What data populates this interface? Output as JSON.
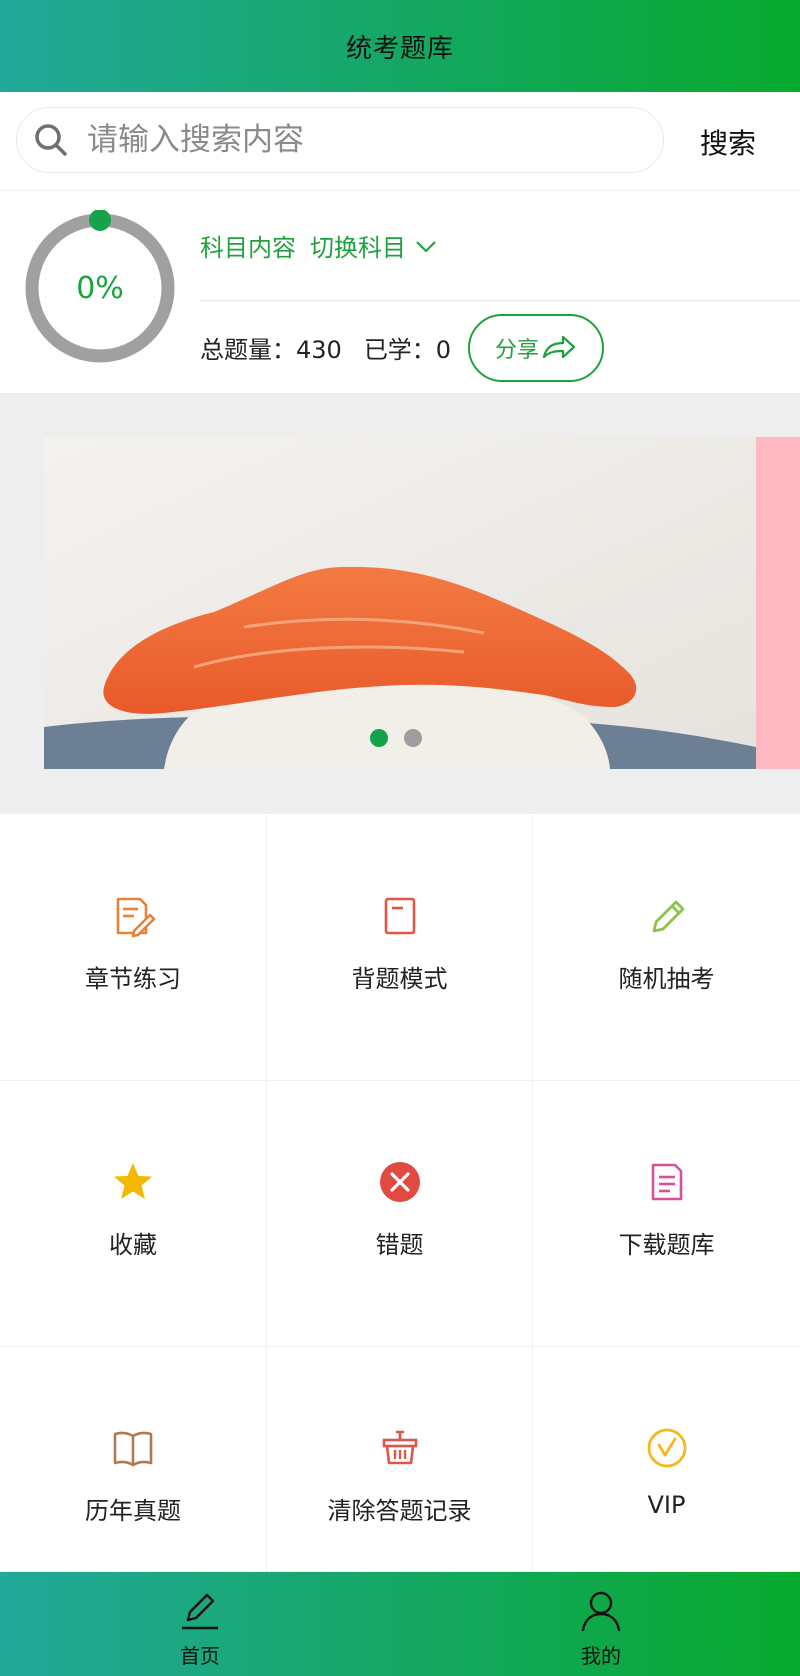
{
  "header": {
    "title": "统考题库"
  },
  "search": {
    "placeholder": "请输入搜索内容",
    "value": "",
    "button_label": "搜索"
  },
  "progress": {
    "percent_text": "0%",
    "percent": 0,
    "subject_label": "科目内容",
    "switch_label": "切换科目",
    "total_text": "总题量：430",
    "learned_text": "已学：0",
    "share_label": "分享"
  },
  "banner": {
    "slide_count": 2,
    "active_index": 0
  },
  "menu": {
    "items": [
      {
        "label": "章节练习",
        "icon": "chapter-practice-icon",
        "color": "#e8823a"
      },
      {
        "label": "背题模式",
        "icon": "memorize-mode-icon",
        "color": "#e0574a"
      },
      {
        "label": "随机抽考",
        "icon": "random-exam-icon",
        "color": "#8bc34a"
      },
      {
        "label": "收藏",
        "icon": "favorite-star-icon",
        "color": "#f5b800"
      },
      {
        "label": "错题",
        "icon": "wrong-questions-icon",
        "color": "#e14a43"
      },
      {
        "label": "下载题库",
        "icon": "download-bank-icon",
        "color": "#d94f9a"
      },
      {
        "label": "历年真题",
        "icon": "past-exams-book-icon",
        "color": "#b07a50"
      },
      {
        "label": "清除答题记录",
        "icon": "clear-records-icon",
        "color": "#e0574a"
      },
      {
        "label": "VIP",
        "icon": "vip-icon",
        "color": "#f2b91a"
      }
    ]
  },
  "tabbar": {
    "home_label": "首页",
    "mine_label": "我的"
  },
  "colors": {
    "brand_green": "#1fa23d",
    "gradient_start": "#23a89a",
    "gradient_end": "#08aa2e"
  }
}
